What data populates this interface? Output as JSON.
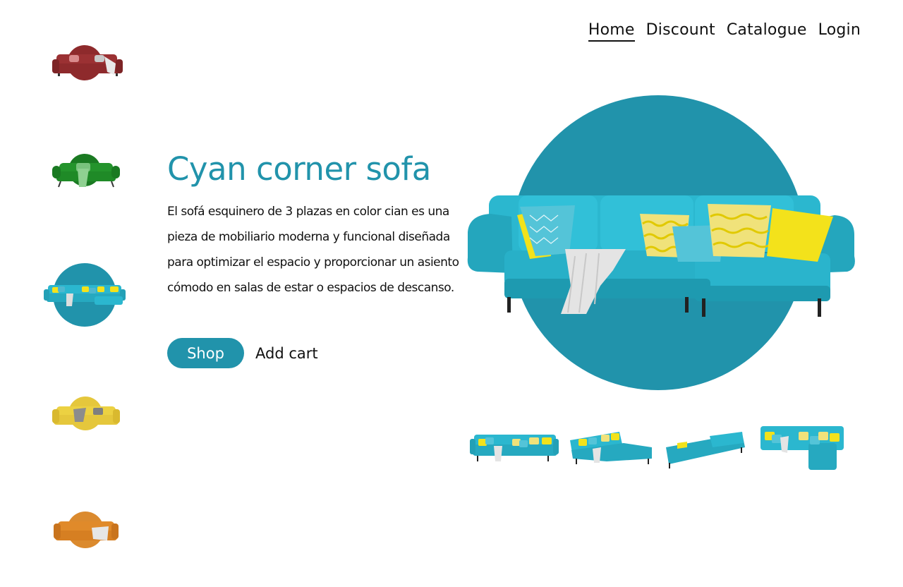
{
  "nav": {
    "items": [
      {
        "label": "Home",
        "active": true
      },
      {
        "label": "Discount",
        "active": false
      },
      {
        "label": "Catalogue",
        "active": false
      },
      {
        "label": "Login",
        "active": false
      }
    ]
  },
  "picker": {
    "items": [
      {
        "name": "red-sofa",
        "color": "#8e2a2c",
        "disc": "#8e2a2c"
      },
      {
        "name": "green-sofa",
        "color": "#1f8a27",
        "disc": "#1a7a22"
      },
      {
        "name": "cyan-sofa",
        "color": "#2bb7cf",
        "disc": "#2193ab",
        "selected": true
      },
      {
        "name": "yellow-sofa",
        "color": "#ecd142",
        "disc": "#e5c73c"
      },
      {
        "name": "orange-sofa",
        "color": "#e08a2a",
        "disc": "#db8a2e"
      }
    ]
  },
  "hero": {
    "title": "Cyan corner sofa",
    "description": "El sofá esquinero de 3 plazas en color cian es una pieza de mobiliario moderna y funcional diseñada para optimizar el espacio y proporcionar un asiento cómodo en salas de estar o espacios de descanso.",
    "shop_label": "Shop",
    "cart_label": "Add cart",
    "accent_color": "#2193ab",
    "sofa_color": "#2bb7cf",
    "pillow_color": "#f3e21b"
  },
  "thumbnails": [
    {
      "name": "front-view"
    },
    {
      "name": "angle-view"
    },
    {
      "name": "back-view"
    },
    {
      "name": "top-view"
    }
  ]
}
